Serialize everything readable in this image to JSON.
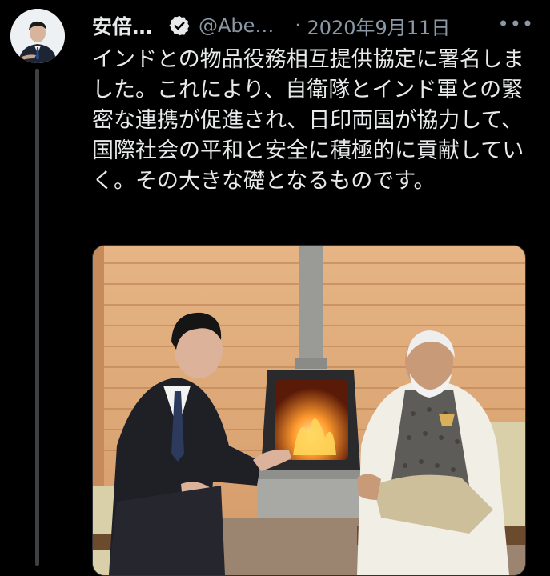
{
  "author": {
    "display_name": "安倍…",
    "handle": "@Abe…",
    "verified": true,
    "avatar_icon": "profile-photo"
  },
  "tweet": {
    "date": "2020年9月11日",
    "separator": "·",
    "more_label": "•••",
    "text": "インドとの物品役務相互提供協定に署名しました。これにより、自衛隊とインド軍との緊密な連携が促進され、日印両国が協力して、国際社会の平和と安全に積極的に貢献していく。その大きな礎となるものです。"
  },
  "media": {
    "type": "photo",
    "subject": "two-leaders-seated-by-fireplace"
  },
  "colors": {
    "background": "#000000",
    "text": "#e7e9ea",
    "secondary": "#8b98a5",
    "thread_line": "#3e4144"
  }
}
